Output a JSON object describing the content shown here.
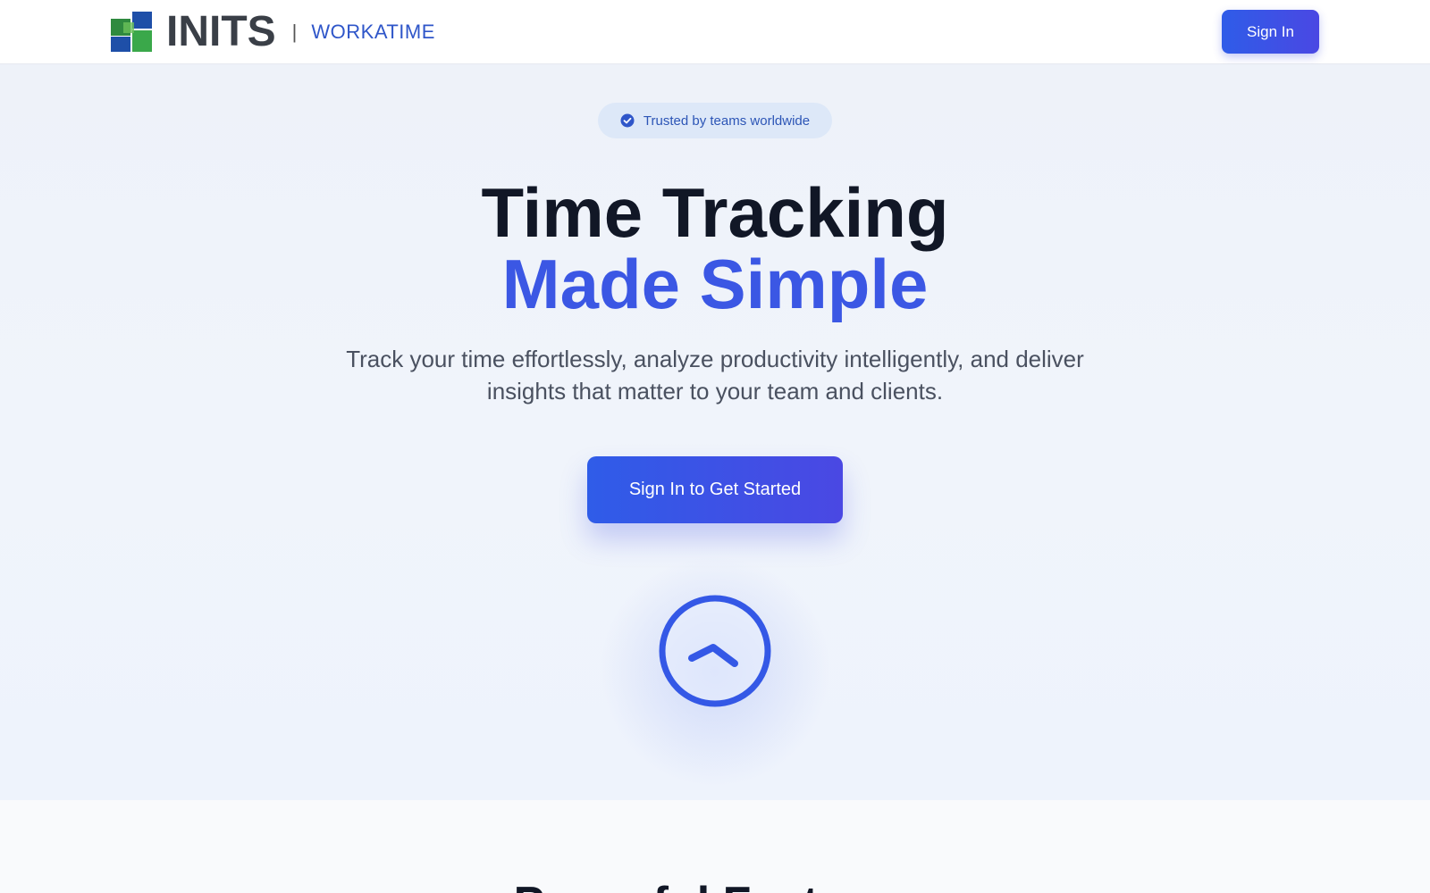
{
  "navbar": {
    "logo_text": "INITS",
    "separator": "|",
    "product_name": "WORKATIME",
    "signin_label": "Sign In"
  },
  "hero": {
    "badge_text": "Trusted by teams worldwide",
    "badge_icon": "check-circle-icon",
    "title_line1": "Time Tracking",
    "title_line2": "Made Simple",
    "subtitle": "Track your time effortlessly, analyze productivity intelligently, and deliver insights that matter to your team and clients.",
    "cta_label": "Sign In to Get Started",
    "hero_icon": "clock-icon"
  },
  "features": {
    "title": "Powerful Features"
  },
  "colors": {
    "accent": "#3b57e4",
    "button_start": "#2f5ce8",
    "button_end": "#4a48e3",
    "heading": "#111726",
    "badge_bg": "#dde8f8"
  }
}
